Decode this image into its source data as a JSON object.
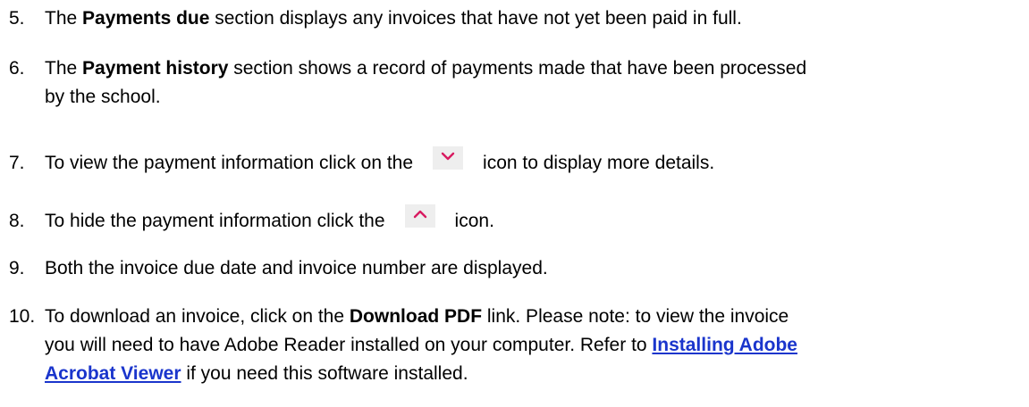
{
  "items": [
    {
      "number": "5.",
      "pre": "The ",
      "bold": "Payments due",
      "post": " section displays any invoices that have not yet been paid in full."
    },
    {
      "number": "6.",
      "pre": "The ",
      "bold": "Payment history",
      "post": " section shows a record of payments made that have been processed",
      "line2": "by the school."
    },
    {
      "number": "7.",
      "pre": "To view the payment information click on the",
      "icon": "chevron-down-icon",
      "post": "icon to display more details."
    },
    {
      "number": "8.",
      "pre": "To hide the payment information click the",
      "icon": "chevron-up-icon",
      "post": "icon."
    },
    {
      "number": "9.",
      "text": "Both the invoice due date and invoice number are displayed."
    },
    {
      "number": "10.",
      "pre": "To download an invoice, click on the ",
      "bold": "Download PDF",
      "post": " link.  Please note: to view the invoice",
      "line2": "you will need to have Adobe Reader installed on your computer. Refer to ",
      "link_part1": "Installing Adobe",
      "link_part2": "Acrobat Viewer",
      "line3_post": " if you need this software installed."
    }
  ],
  "colors": {
    "icon_accent": "#d81b60",
    "icon_background": "#eeeeee",
    "link": "#1a35cc"
  }
}
